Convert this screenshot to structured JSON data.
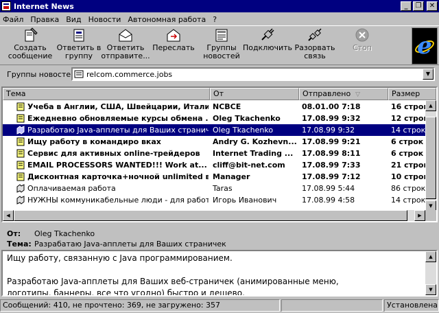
{
  "window": {
    "title": "Internet News"
  },
  "menu": [
    "Файл",
    "Правка",
    "Вид",
    "Новости",
    "Автономная работа",
    "?"
  ],
  "toolbar": {
    "buttons": [
      {
        "label1": "Создать",
        "label2": "сообщение",
        "icon": "new-post-icon"
      },
      {
        "label1": "Ответить в",
        "label2": "группу",
        "icon": "reply-group-icon"
      },
      {
        "label1": "Ответить",
        "label2": "отправите...",
        "icon": "reply-author-icon"
      },
      {
        "label1": "Переслать",
        "label2": "",
        "icon": "forward-icon"
      },
      {
        "label1": "Группы",
        "label2": "новостей",
        "icon": "newsgroups-icon"
      },
      {
        "label1": "Подключить",
        "label2": "",
        "icon": "connect-icon"
      },
      {
        "label1": "Разорвать",
        "label2": "связь",
        "icon": "disconnect-icon"
      },
      {
        "label1": "Стоп",
        "label2": "",
        "icon": "stop-icon",
        "disabled": true
      }
    ]
  },
  "groupbar": {
    "label": "Группы новостей",
    "value": "relcom.commerce.jobs"
  },
  "list": {
    "columns": [
      "Тема",
      "От",
      "Отправлено",
      "Размер"
    ],
    "sort_icon": "sort-down-arrow-icon",
    "rows": [
      {
        "subject": "Учеба в Англии, США, Швейцарии, Итали...",
        "from": "NCBCE",
        "sent": "08.01.00 7:18",
        "size": "16 строк",
        "unread": true,
        "icon": "message-page-icon"
      },
      {
        "subject": "Ежедневно обновляемые курсы обмена ...",
        "from": "Oleg Tkachenko",
        "sent": "17.08.99 9:32",
        "size": "12 строк",
        "unread": true,
        "icon": "message-page-icon"
      },
      {
        "subject": "Разработаю Java-апплеты для Ваших страничек",
        "from": "Oleg Tkachenko",
        "sent": "17.08.99 9:32",
        "size": "14 строк",
        "unread": false,
        "selected": true,
        "icon": "read-message-icon"
      },
      {
        "subject": "Ищу работу в командиро     вках",
        "from": "Andry G. Kozhevn...",
        "sent": "17.08.99 9:21",
        "size": "6 строк",
        "unread": true,
        "icon": "message-page-icon"
      },
      {
        "subject": "Сервис для активных online-трейдеров",
        "from": "Internet Trading ...",
        "sent": "17.08.99 8:11",
        "size": "6 строк",
        "unread": true,
        "icon": "message-page-icon"
      },
      {
        "subject": "EMAIL PROCESSORS WANTED!!! Work at...",
        "from": "cliff@bit-net.com",
        "sent": "17.08.99 7:33",
        "size": "21 строк",
        "unread": true,
        "icon": "message-page-icon"
      },
      {
        "subject": "Дисконтная карточка+ночной unlimited в...",
        "from": "Manager",
        "sent": "17.08.99 7:12",
        "size": "10 строк",
        "unread": true,
        "icon": "message-page-icon"
      },
      {
        "subject": "Оплачиваемая работа",
        "from": "Taras",
        "sent": "17.08.99 5:44",
        "size": "86 строк",
        "unread": false,
        "icon": "read-message-icon"
      },
      {
        "subject": "НУЖНЫ коммуникабельные люди - для работы ...",
        "from": "Игорь Иванович",
        "sent": "17.08.99 4:58",
        "size": "14 строк",
        "unread": false,
        "icon": "read-message-icon"
      }
    ]
  },
  "preview": {
    "from_label": "От:",
    "from": "Oleg Tkachenko",
    "subject_label": "Тема:",
    "subject": "Разрабатаю Java-апплеты для Ваших страничек",
    "body": "Ищу работу, связанную с Java программированием.\n\nРазработаю Java-апплеты для Ваших веб-страничек (анимированные меню,\nлоготипы, баннеры, все что угодно) быстро и дешево."
  },
  "status": {
    "left": "Сообщений: 410, не прочтено: 369, не загружено: 357",
    "middle": "",
    "right": "Установлена с"
  }
}
